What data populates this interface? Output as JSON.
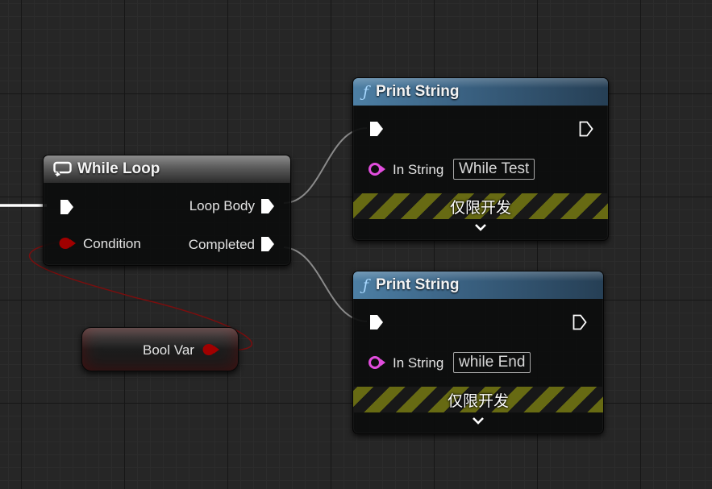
{
  "graph": {
    "while_loop": {
      "title": "While Loop",
      "icon": "loop-icon",
      "pins": {
        "exec_in": "",
        "condition": "Condition",
        "loop_body": "Loop Body",
        "completed": "Completed"
      }
    },
    "print_string_1": {
      "title": "Print String",
      "icon": "function-icon",
      "in_string_label": "In String",
      "in_string_value": "While Test",
      "dev_only_label": "仅限开发"
    },
    "print_string_2": {
      "title": "Print String",
      "icon": "function-icon",
      "in_string_label": "In String",
      "in_string_value": "while End",
      "dev_only_label": "仅限开发"
    },
    "bool_var": {
      "label": "Bool Var"
    }
  },
  "colors": {
    "background": "#262626",
    "exec_pin": "#ffffff",
    "bool_pin": "#9a0000",
    "string_pin": "#e14ddd",
    "function_header": "#3b6384",
    "dev_stripe": "#676a13"
  }
}
